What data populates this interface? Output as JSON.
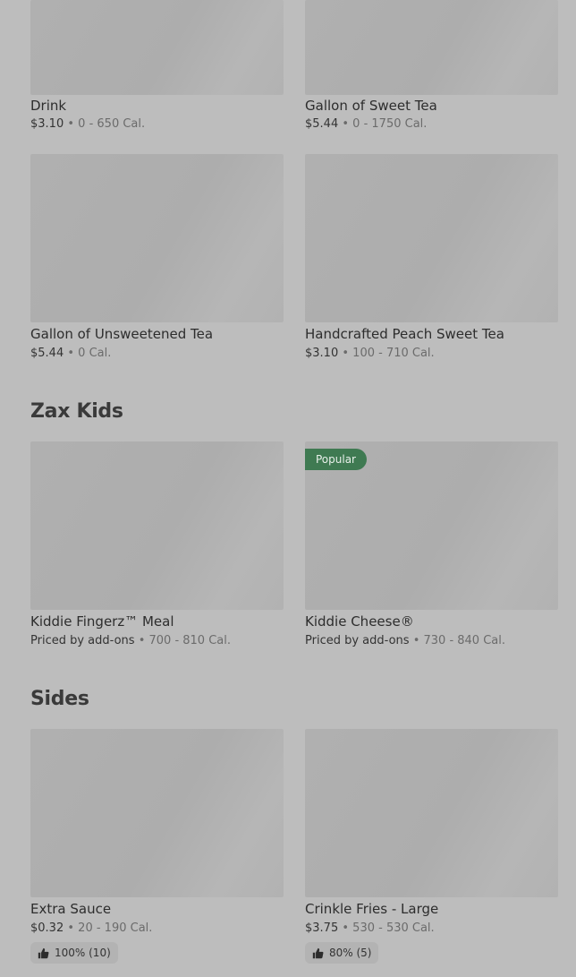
{
  "sections": {
    "drinks_continued": {
      "items": [
        {
          "name": "Drink",
          "price": "$3.10",
          "calories": "0 - 650 Cal."
        },
        {
          "name": "Gallon of Sweet Tea",
          "price": "$5.44",
          "calories": "0 - 1750 Cal."
        },
        {
          "name": "Gallon of Unsweetened Tea",
          "price": "$5.44",
          "calories": "0 Cal."
        },
        {
          "name": "Handcrafted Peach Sweet Tea",
          "price": "$3.10",
          "calories": "100 - 710 Cal."
        }
      ]
    },
    "zax_kids": {
      "title": "Zax Kids",
      "items": [
        {
          "name": "Kiddie Fingerz™ Meal",
          "price": "Priced by add-ons",
          "calories": "700 - 810 Cal."
        },
        {
          "name": "Kiddie Cheese®",
          "price": "Priced by add-ons",
          "calories": "730 - 840 Cal.",
          "badge": "Popular"
        }
      ]
    },
    "sides": {
      "title": "Sides",
      "items": [
        {
          "name": "Extra Sauce",
          "price": "$0.32",
          "calories": "20 - 190 Cal.",
          "rating": "100% (10)"
        },
        {
          "name": "Crinkle Fries - Large",
          "price": "$3.75",
          "calories": "530 - 530 Cal.",
          "rating": "80% (5)"
        }
      ]
    }
  },
  "separator": "•",
  "colors": {
    "background": "#bdbdbd",
    "badge": "#3f7a52",
    "placeholder": "#afafaf"
  },
  "icons": {
    "rating": "thumbs-up-icon"
  }
}
